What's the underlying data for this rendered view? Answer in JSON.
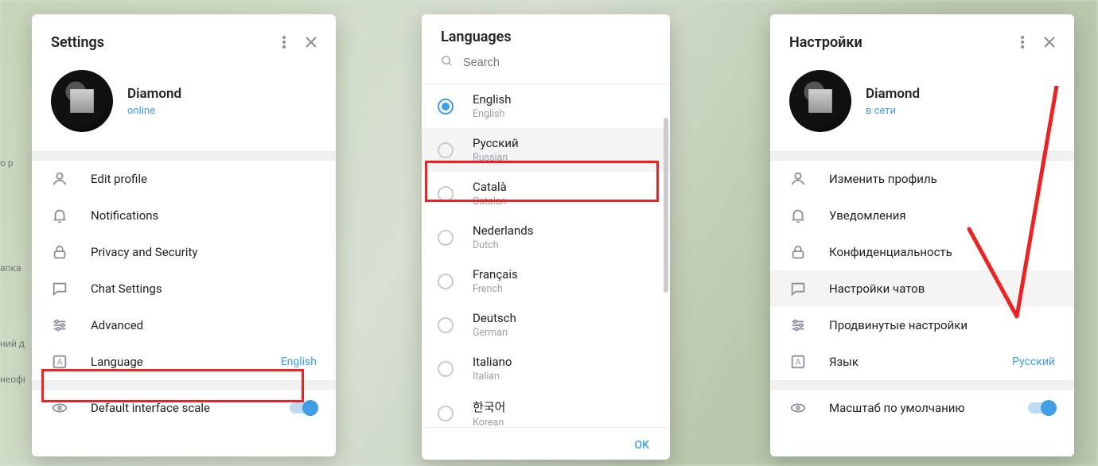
{
  "panel1": {
    "title": "Settings",
    "profile": {
      "name": "Diamond",
      "status": "online"
    },
    "items": [
      {
        "icon": "person",
        "label": "Edit profile"
      },
      {
        "icon": "bell",
        "label": "Notifications"
      },
      {
        "icon": "lock",
        "label": "Privacy and Security"
      },
      {
        "icon": "chat",
        "label": "Chat Settings"
      },
      {
        "icon": "sliders",
        "label": "Advanced"
      },
      {
        "icon": "lang",
        "label": "Language",
        "value": "English",
        "highlight": true
      }
    ],
    "scale": {
      "label": "Default interface scale",
      "on": true
    }
  },
  "panel2": {
    "title": "Languages",
    "search_placeholder": "Search",
    "languages": [
      {
        "native": "English",
        "english": "English",
        "selected": true
      },
      {
        "native": "Русский",
        "english": "Russian",
        "highlight": true
      },
      {
        "native": "Català",
        "english": "Catalan"
      },
      {
        "native": "Nederlands",
        "english": "Dutch"
      },
      {
        "native": "Français",
        "english": "French"
      },
      {
        "native": "Deutsch",
        "english": "German"
      },
      {
        "native": "Italiano",
        "english": "Italian"
      },
      {
        "native": "한국어",
        "english": "Korean"
      }
    ],
    "ok": "OK"
  },
  "panel3": {
    "title": "Настройки",
    "profile": {
      "name": "Diamond",
      "status": "в сети"
    },
    "items": [
      {
        "icon": "person",
        "label": "Изменить профиль"
      },
      {
        "icon": "bell",
        "label": "Уведомления"
      },
      {
        "icon": "lock",
        "label": "Конфиденциальность"
      },
      {
        "icon": "chat",
        "label": "Настройки чатов",
        "selected": true
      },
      {
        "icon": "sliders",
        "label": "Продвинутые настройки"
      },
      {
        "icon": "lang",
        "label": "Язык",
        "value": "Русский"
      }
    ],
    "scale": {
      "label": "Масштаб по умолчанию",
      "on": true
    }
  }
}
